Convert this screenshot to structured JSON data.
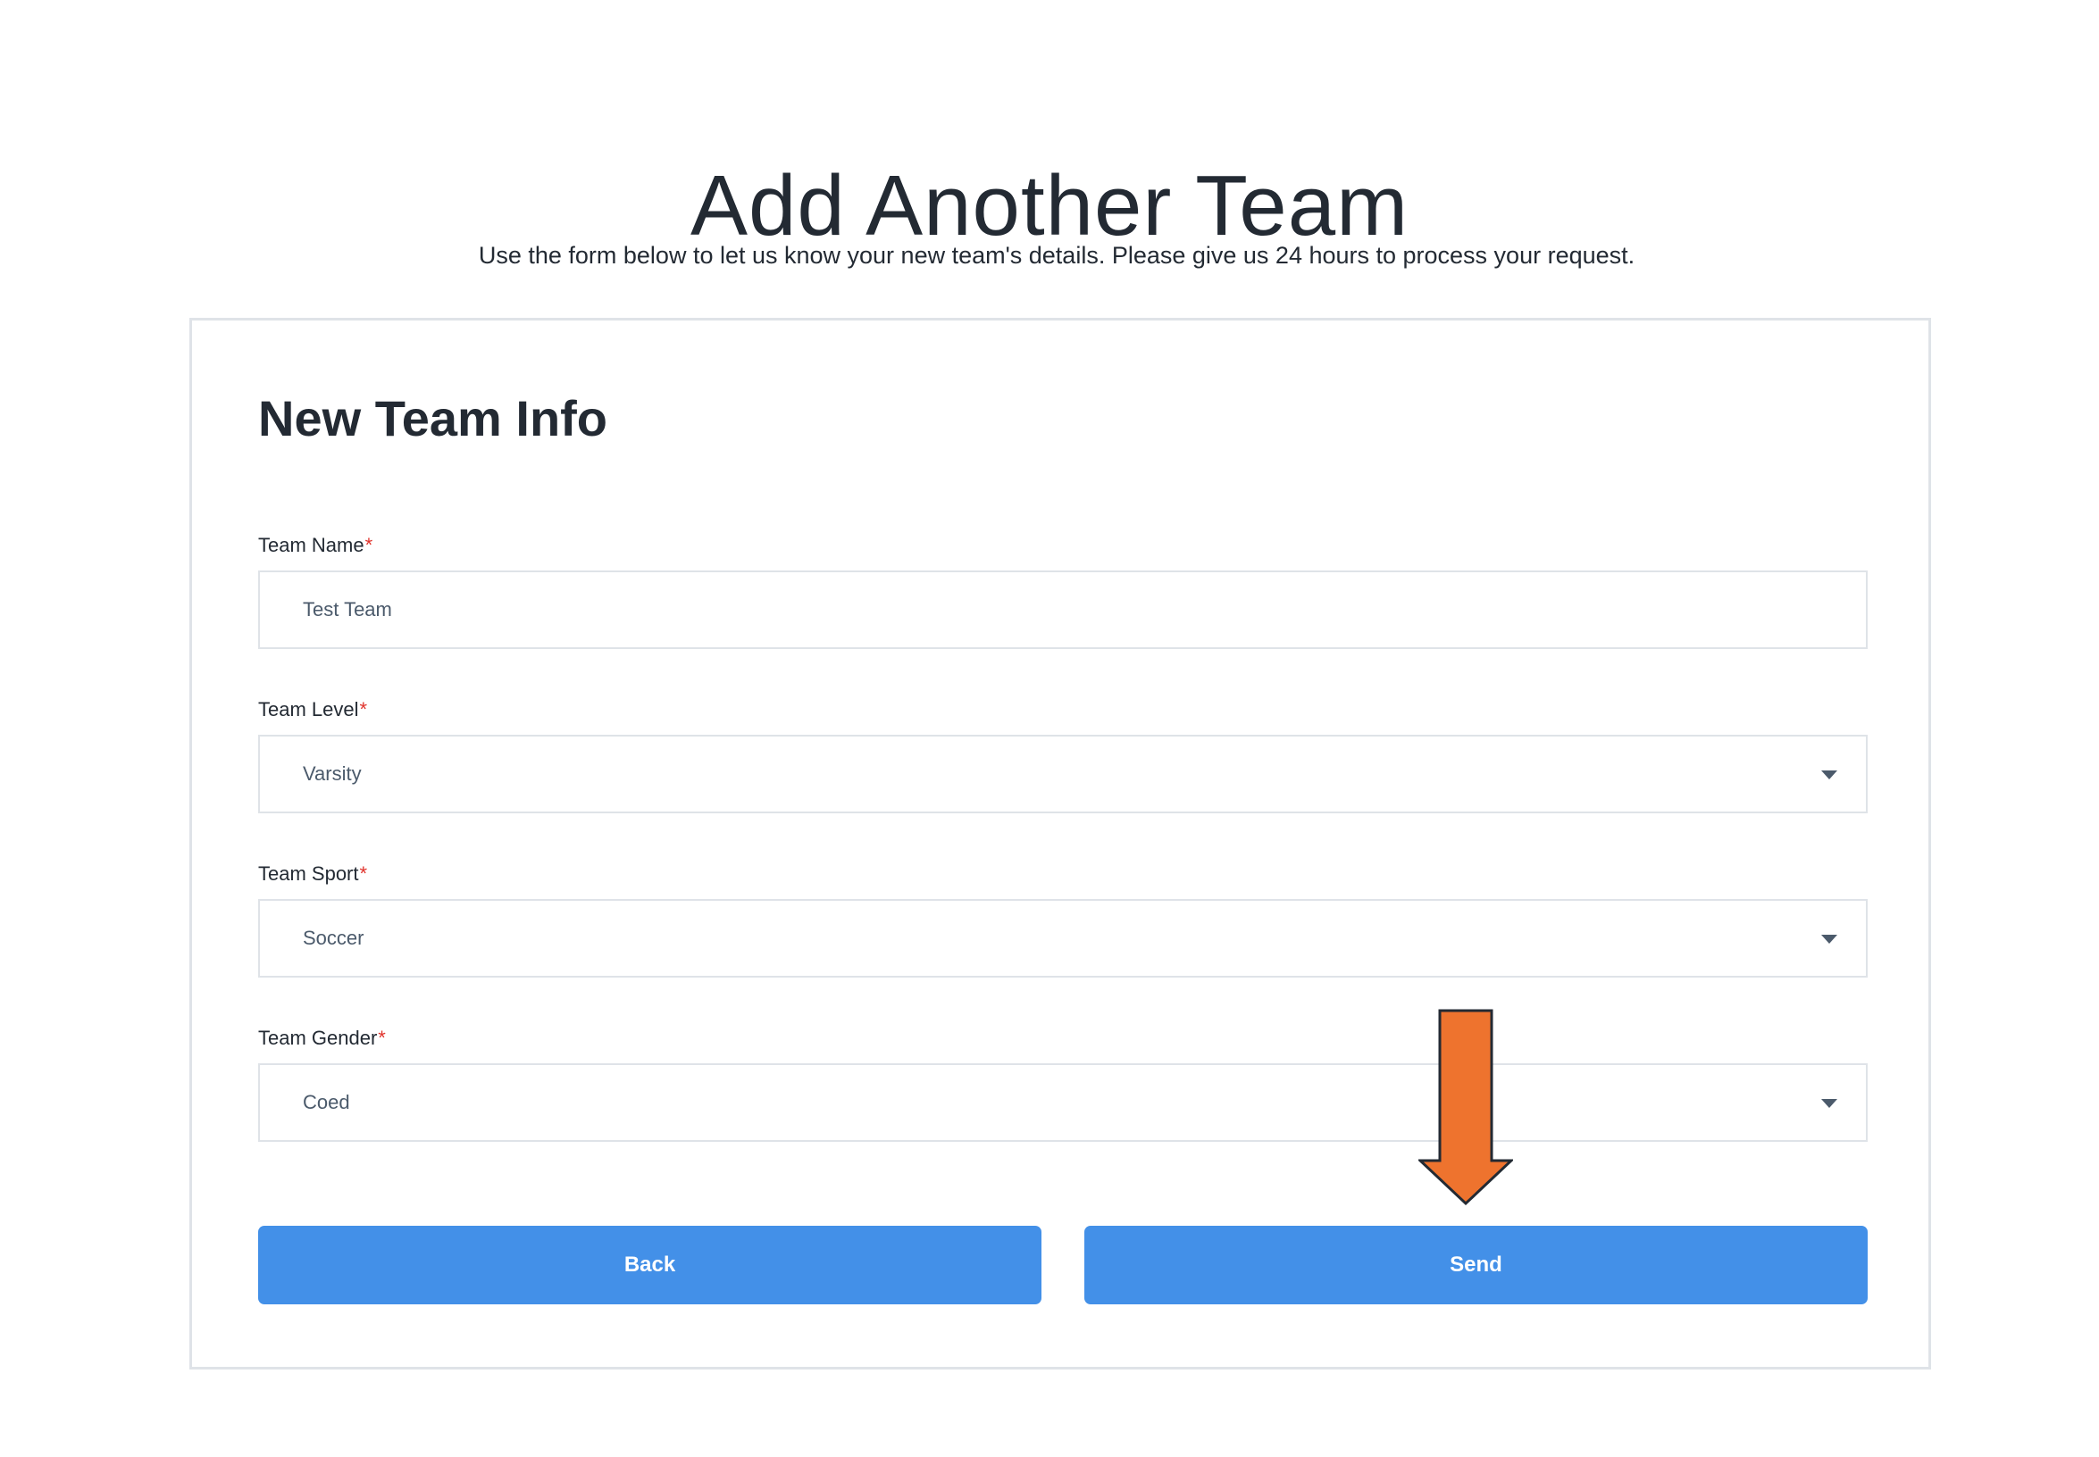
{
  "page": {
    "title": "Add Another Team",
    "subtitle": "Use the form below to let us know your new team's details. Please give us 24 hours to process your request."
  },
  "form": {
    "heading": "New Team Info",
    "required_marker": "*",
    "fields": [
      {
        "label": "Team Name",
        "value": "Test Team",
        "type": "text"
      },
      {
        "label": "Team Level",
        "value": "Varsity",
        "type": "select"
      },
      {
        "label": "Team Sport",
        "value": "Soccer",
        "type": "select"
      },
      {
        "label": "Team Gender",
        "value": "Coed",
        "type": "select"
      }
    ],
    "buttons": {
      "back_label": "Back",
      "send_label": "Send"
    }
  },
  "colors": {
    "button": "#4390e8",
    "required": "#e0322b",
    "annotation_arrow": "#ee732e",
    "border": "#dfe3e8"
  },
  "icons": {
    "dropdown": "chevron-down-icon",
    "annotation": "down-arrow-icon"
  }
}
